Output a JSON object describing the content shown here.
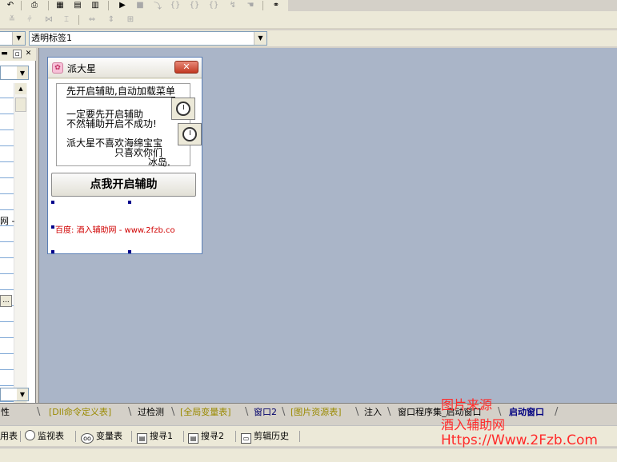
{
  "toolbar": {
    "row1_icons": [
      "undo-icon",
      "find-icon",
      "layout-1-icon",
      "layout-2-icon",
      "layout-3-icon",
      "run-icon",
      "stop-icon",
      "step-into-icon",
      "step-over-icon",
      "step-out-icon",
      "breakpoint-icon",
      "tool-icon",
      "hand-icon",
      "binoculars-icon"
    ],
    "row2_icons": [
      "align-top-icon",
      "align-middle-icon",
      "distribute-h-icon",
      "distribute-v-icon",
      "same-width-icon",
      "same-height-icon",
      "center-icon"
    ]
  },
  "combos": {
    "object_combo_value": "",
    "control_combo_value": "透明标签1"
  },
  "left_panel": {
    "partial_row_text": "网 -",
    "dots_button": "...",
    "bottom_tab_stub": "性"
  },
  "form": {
    "title": "派大星",
    "close_symbol": "✕",
    "memo_lines": [
      "先开启辅助,自动加载菜单",
      "一定要先开启辅助",
      "不然辅助开启不成功!",
      "派大星不喜欢海绵宝宝",
      "只喜欢你们",
      "冰岛."
    ],
    "start_button": "点我开启辅助",
    "red_label": "百度: 酒入辅助网 - www.2fzb.co"
  },
  "tabs": [
    {
      "label": "[Dll命令定义表]",
      "style": "yellow"
    },
    {
      "label": "过检测",
      "style": "dark"
    },
    {
      "label": "[全局变量表]",
      "style": "yellow"
    },
    {
      "label": "窗口2",
      "style": "blue"
    },
    {
      "label": "[图片资源表]",
      "style": "yellow"
    },
    {
      "label": "注入",
      "style": "dark"
    },
    {
      "label": "窗口程序集_启动窗口",
      "style": "dark"
    },
    {
      "label": "启动窗口",
      "style": "active"
    }
  ],
  "status": {
    "items": [
      {
        "label": "用表",
        "icon": ""
      },
      {
        "label": "监视表",
        "icon": "magnifier-icon"
      },
      {
        "label": "变量表",
        "icon": "glasses-icon"
      },
      {
        "label": "搜寻1",
        "icon": "search-doc-icon"
      },
      {
        "label": "搜寻2",
        "icon": "search-doc-icon"
      },
      {
        "label": "剪辑历史",
        "icon": "clipboard-icon"
      }
    ]
  },
  "watermark": {
    "line1": "图片来源",
    "line2": "酒入辅助网",
    "line3": "Https://Www.2Fzb.Com"
  }
}
